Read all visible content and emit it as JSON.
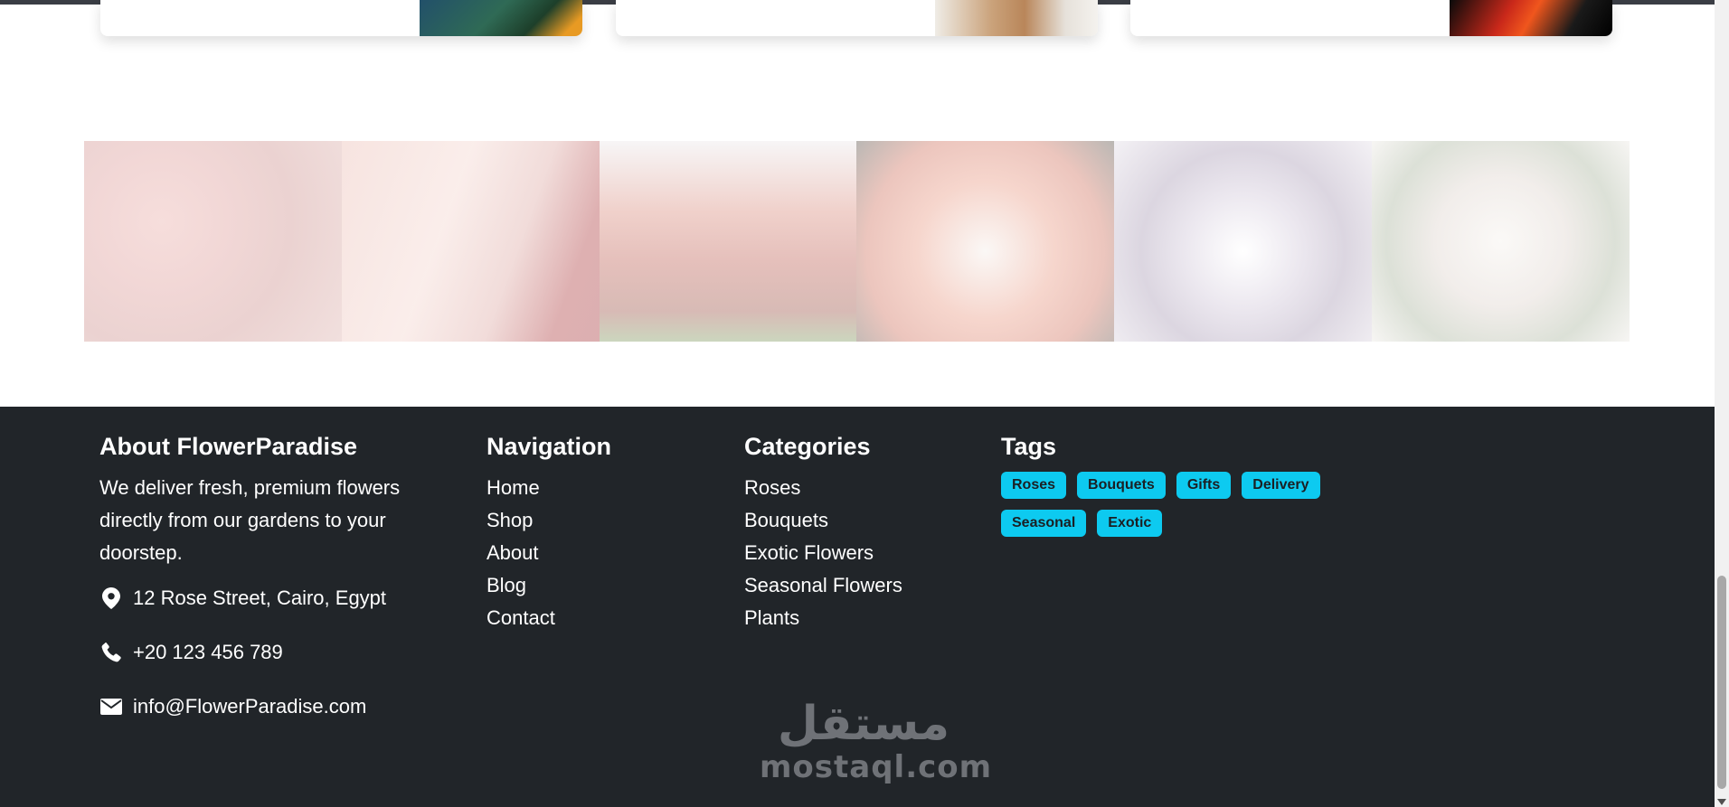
{
  "footer": {
    "about": {
      "title": "About FlowerParadise",
      "text": "We deliver fresh, premium flowers directly from our gardens to your doorstep.",
      "address": "12 Rose Street, Cairo, Egypt",
      "phone": "+20 123 456 789",
      "email": "info@FlowerParadise.com"
    },
    "navigation": {
      "title": "Navigation",
      "links": [
        "Home",
        "Shop",
        "About",
        "Blog",
        "Contact"
      ]
    },
    "categories": {
      "title": "Categories",
      "links": [
        "Roses",
        "Bouquets",
        "Exotic Flowers",
        "Seasonal Flowers",
        "Plants"
      ]
    },
    "tags": {
      "title": "Tags",
      "items": [
        "Roses",
        "Bouquets",
        "Gifts",
        "Delivery",
        "Seasonal",
        "Exotic"
      ]
    }
  },
  "watermark": {
    "arabic": "مستقل",
    "latin": "mostaql.com"
  },
  "colors": {
    "footer_bg": "#212529",
    "tag_bg": "#0dcaf0",
    "tag_text": "#1b1f23"
  },
  "icons": [
    "map-pin-icon",
    "phone-icon",
    "envelope-icon"
  ]
}
